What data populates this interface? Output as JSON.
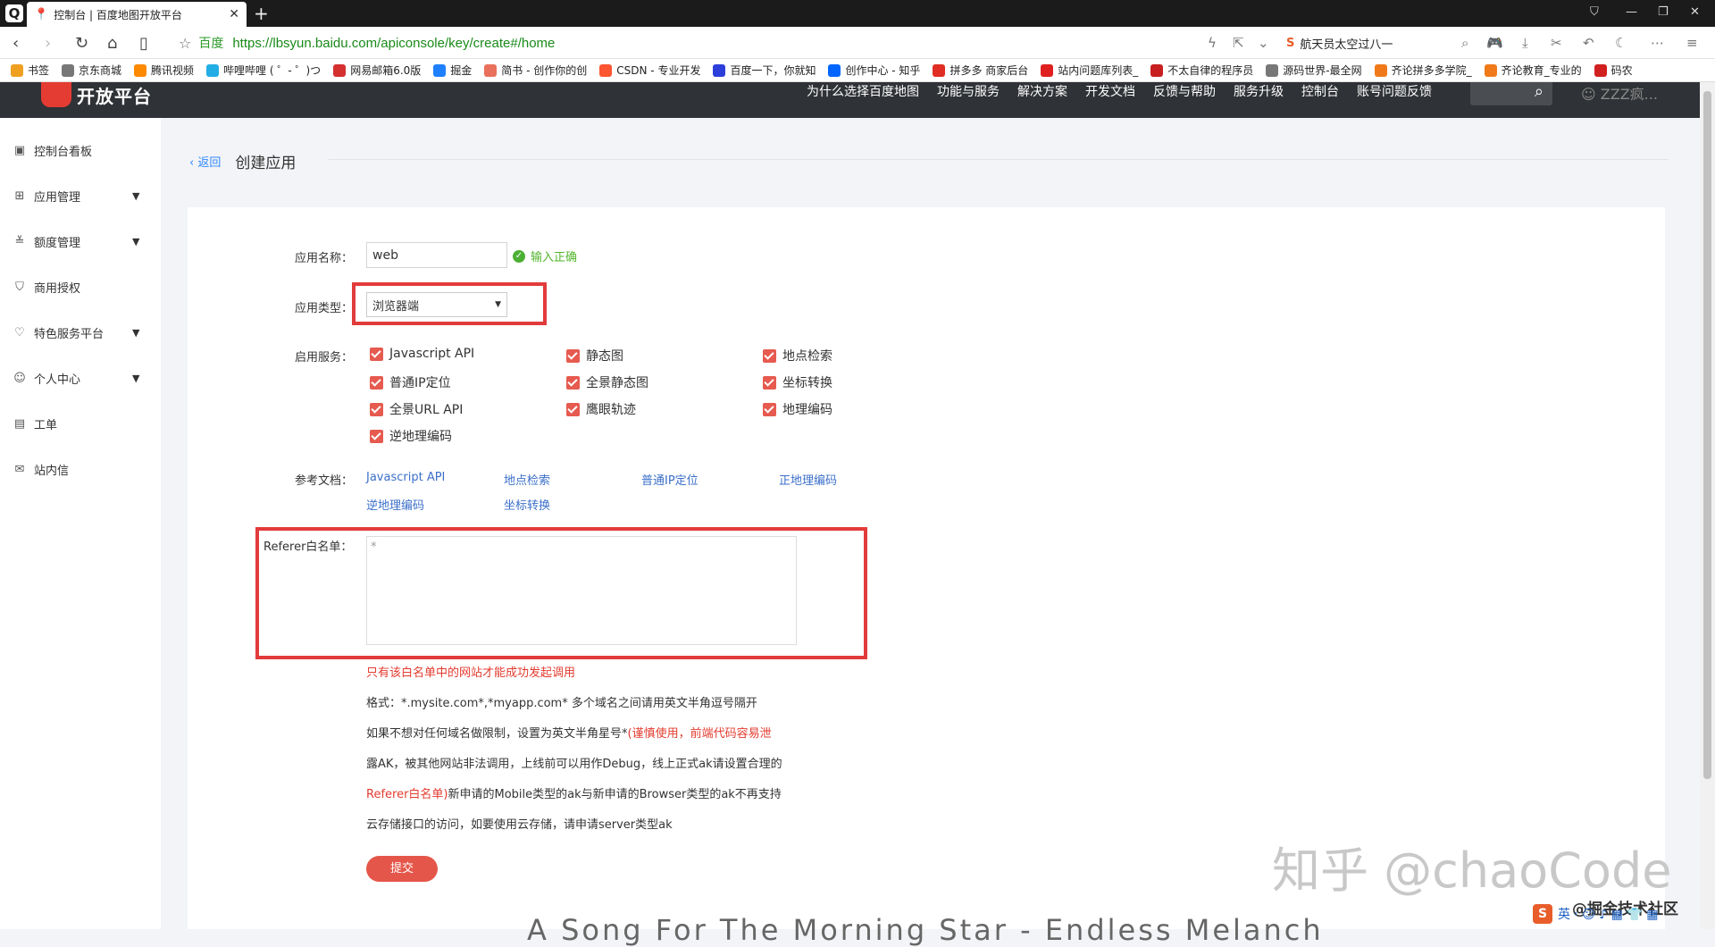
{
  "browser": {
    "tab_title": "控制台 | 百度地图开放平台",
    "new_tab": "+",
    "site_label": "百度",
    "url": "https://lbsyun.baidu.com/apiconsole/key/create#/home",
    "search_text": "航天员太空过八一",
    "bookmarks": [
      {
        "label": "书签",
        "color": "#f0a020"
      },
      {
        "label": "京东商城",
        "color": "#777777"
      },
      {
        "label": "腾讯视频",
        "color": "#ff8a00"
      },
      {
        "label": "哔哩哔哩 ( ゜- ゜)つ",
        "color": "#23ade5"
      },
      {
        "label": "网易邮箱6.0版",
        "color": "#d43030"
      },
      {
        "label": "掘金",
        "color": "#1e80ff"
      },
      {
        "label": "简书 - 创作你的创",
        "color": "#e9705a"
      },
      {
        "label": "CSDN - 专业开发",
        "color": "#fc5531"
      },
      {
        "label": "百度一下，你就知",
        "color": "#2d3fdb"
      },
      {
        "label": "创作中心 - 知乎",
        "color": "#0066ff"
      },
      {
        "label": "拼多多 商家后台",
        "color": "#e02e24"
      },
      {
        "label": "站内问题库列表_",
        "color": "#e02020"
      },
      {
        "label": "不太自律的程序员",
        "color": "#c82020"
      },
      {
        "label": "源码世界-最全网",
        "color": "#777777"
      },
      {
        "label": "齐论拼多多学院_",
        "color": "#f07a1a"
      },
      {
        "label": "齐论教育_专业的",
        "color": "#f07a1a"
      },
      {
        "label": "码农",
        "color": "#d02020"
      }
    ]
  },
  "header": {
    "brand": "开放平台",
    "nav": [
      "为什么选择百度地图",
      "功能与服务",
      "解决方案",
      "开发文档",
      "反馈与帮助",
      "服务升级",
      "控制台",
      "账号问题反馈"
    ],
    "user": "ZZZ疯..."
  },
  "sidebar": {
    "items": [
      {
        "label": "控制台看板",
        "icon": "dashboard-icon",
        "glyph": "▣",
        "arrow": false
      },
      {
        "label": "应用管理",
        "icon": "grid-icon",
        "glyph": "⊞",
        "arrow": true
      },
      {
        "label": "额度管理",
        "icon": "sliders-icon",
        "glyph": "≚",
        "arrow": true
      },
      {
        "label": "商用授权",
        "icon": "shield-icon",
        "glyph": "⛉",
        "arrow": false
      },
      {
        "label": "特色服务平台",
        "icon": "heart-icon",
        "glyph": "♡",
        "arrow": true
      },
      {
        "label": "个人中心",
        "icon": "user-icon",
        "glyph": "☺",
        "arrow": true
      },
      {
        "label": "工单",
        "icon": "clipboard-icon",
        "glyph": "▤",
        "arrow": false
      },
      {
        "label": "站内信",
        "icon": "mail-icon",
        "glyph": "✉",
        "arrow": false
      }
    ],
    "arrow_glyph": "▼"
  },
  "page": {
    "back": "返回",
    "title": "创建应用"
  },
  "form": {
    "name_label": "应用名称：",
    "name_value": "web",
    "name_ok": "输入正确",
    "type_label": "应用类型：",
    "type_value": "浏览器端",
    "services_label": "启用服务：",
    "services": [
      "Javascript API",
      "静态图",
      "地点检索",
      "普通IP定位",
      "全景静态图",
      "坐标转换",
      "全景URL API",
      "鹰眼轨迹",
      "地理编码",
      "逆地理编码"
    ],
    "docs_label": "参考文档：",
    "docs": [
      "Javascript API",
      "地点检索",
      "普通IP定位",
      "正地理编码",
      "逆地理编码",
      "坐标转换"
    ],
    "referer_label": "Referer白名单：",
    "referer_value": "*",
    "note_red": "只有该白名单中的网站才能成功发起调用",
    "note_format": "格式：*.mysite.com*,*myapp.com* 多个域名之间请用英文半角逗号隔开",
    "note_line3_a": "如果不想对任何域名做限制，设置为英文半角星号*",
    "note_line3_b": "(谨慎使用，前端代码容易泄",
    "note_line4": "露AK，被其他网站非法调用，上线前可以用作Debug，线上正式ak请设置合理的",
    "note_line5_a": "Referer白名单)",
    "note_line5_b": "新申请的Mobile类型的ak与新申请的Browser类型的ak不再支持",
    "note_line6": "云存储接口的访问，如要使用云存储，请申请server类型ak",
    "submit": "提交"
  },
  "overlay": {
    "watermark": "知乎 @chaoCode",
    "watermark2": "@掘金技术社区",
    "lyric": "A Song For The Morning Star - Endless Melanch",
    "tray": "英 ˒ ☺ ♪ ▦ 👕 ▦"
  }
}
